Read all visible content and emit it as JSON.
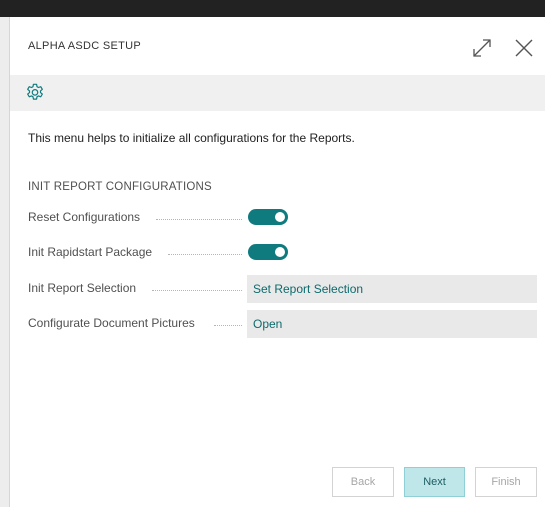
{
  "dialog": {
    "title": "ALPHA ASDC SETUP",
    "expand_icon": "expand-icon",
    "close_icon": "close-icon"
  },
  "actionbar": {
    "icon": "gear-icon"
  },
  "intro": "This menu helps to initialize all configurations for the Reports.",
  "section": {
    "title": "INIT REPORT CONFIGURATIONS",
    "fields": [
      {
        "label": "Reset Configurations",
        "type": "toggle",
        "value": true
      },
      {
        "label": "Init Rapidstart Package",
        "type": "toggle",
        "value": true
      },
      {
        "label": "Init Report Selection",
        "type": "link",
        "value": "Set Report Selection"
      },
      {
        "label": "Configurate Document Pictures",
        "type": "link",
        "value": "Open"
      }
    ]
  },
  "buttons": {
    "back": "Back",
    "next": "Next",
    "finish": "Finish"
  },
  "colors": {
    "accent": "#0f7b7e",
    "link": "#0d6a6d",
    "next_bg": "#bfe7ea"
  }
}
